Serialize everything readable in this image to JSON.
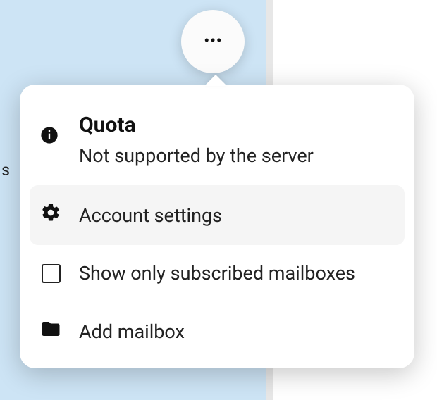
{
  "background": {
    "truncated_text": "s"
  },
  "popover": {
    "quota": {
      "title": "Quota",
      "subtext": "Not supported by the server"
    },
    "items": [
      {
        "label": "Account settings",
        "hovered": true
      },
      {
        "label": "Show only subscribed mailboxes",
        "hovered": false
      },
      {
        "label": "Add mailbox",
        "hovered": false
      }
    ]
  }
}
